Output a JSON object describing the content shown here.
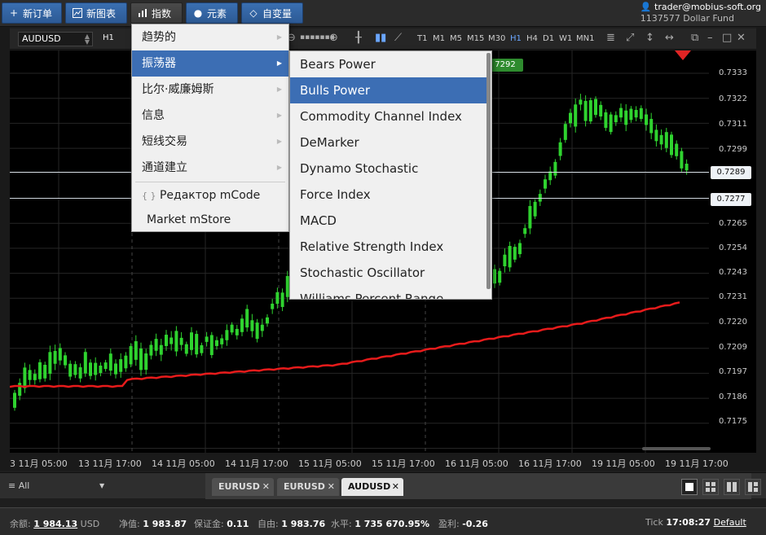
{
  "toolbar": {
    "new_order": "新订单",
    "new_chart": "新图表",
    "indicators": "指数",
    "elements": "元素",
    "custom_var": "自变量"
  },
  "account": {
    "user": "trader@mobius-soft.org",
    "account_line": "1137577  Dollar Fund"
  },
  "chart_header": {
    "symbol": "AUDUSD",
    "timeframe": "H1",
    "timeframes": [
      "T1",
      "M1",
      "M5",
      "M15",
      "M30",
      "H1",
      "H4",
      "D1",
      "W1",
      "MN1"
    ],
    "active_timeframe": "H1"
  },
  "menu_main": {
    "items": [
      {
        "label": "趋势的"
      },
      {
        "label": "振荡器"
      },
      {
        "label": "比尔·威廉姆斯"
      },
      {
        "label": "信息"
      },
      {
        "label": "短线交易"
      },
      {
        "label": "通道建立"
      },
      {
        "label": "Редактор mCode"
      },
      {
        "label": "Market mStore"
      }
    ],
    "selected": "振荡器"
  },
  "menu_oscillators": {
    "items": [
      "Bears Power",
      "Bulls Power",
      "Commodity Channel Index",
      "DeMarker",
      "Dynamo Stochastic",
      "Force Index",
      "MACD",
      "Relative Strength Index",
      "Stochastic Oscillator",
      "Williams Percent Range"
    ],
    "selected": "Bulls Power"
  },
  "price_axis": {
    "ticks": [
      "0.7333",
      "0.7322",
      "0.7311",
      "0.7299",
      "0.7289",
      "0.7277",
      "0.7265",
      "0.7254",
      "0.7243",
      "0.7231",
      "0.7220",
      "0.7209",
      "0.7197",
      "0.7186",
      "0.7175"
    ],
    "tag_bid": "0.7289",
    "tag_ask": "0.7277",
    "tag_partial": "7292"
  },
  "time_axis": {
    "labels": [
      "3 11月 05:00",
      "13 11月 17:00",
      "14 11月 05:00",
      "14 11月 17:00",
      "15 11月 05:00",
      "15 11月 17:00",
      "16 11月 05:00",
      "16 11月 17:00",
      "19 11月 05:00",
      "19 11月 17:00"
    ]
  },
  "tabs": {
    "filter": "All",
    "items": [
      {
        "label": "EURUSD"
      },
      {
        "label": "EURUSD"
      },
      {
        "label": "AUDUSD"
      }
    ],
    "active": "AUDUSD"
  },
  "status": {
    "balance_label": "余额:",
    "balance_value": "1 984.13",
    "balance_currency": "USD",
    "equity_label": "净值:",
    "equity_value": "1 983.87",
    "margin_label": "保证金:",
    "margin_value": "0.11",
    "free_label": "自由:",
    "free_value": "1 983.76",
    "level_label": "水平:",
    "level_value": "1 735 670.95%",
    "profit_label": "盈利:",
    "profit_value": "-0.26",
    "tick_label": "Tick",
    "tick_time": "17:08:27",
    "profile": "Default"
  },
  "colors": {
    "bull_candle": "#2fd32f",
    "ma_line": "#e81b1b",
    "menu_highlight": "#3c6eb4",
    "toolbar_blue": "#2d5a95"
  },
  "icons": {
    "new_order": "plus-icon",
    "new_chart": "chart-window-icon",
    "indicators": "bar-chart-icon",
    "elements": "shapes-icon",
    "custom_var": "diamond-icon",
    "user": "user-icon",
    "code": "code-braces-icon"
  }
}
